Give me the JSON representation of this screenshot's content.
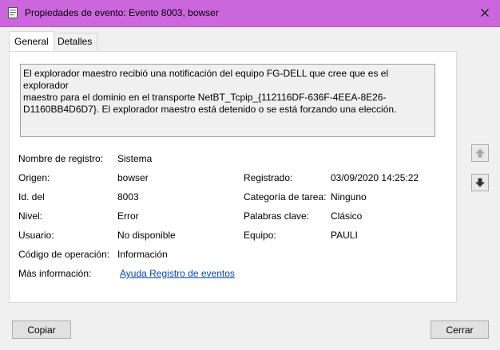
{
  "window": {
    "title": "Propiedades de evento: Evento 8003, bowser"
  },
  "tabs": [
    {
      "label": "General"
    },
    {
      "label": "Detalles"
    }
  ],
  "description": "El explorador maestro recibió una notificación del equipo FG-DELL que cree que es el explorador\nmaestro para el dominio en el transporte NetBT_Tcpip_{112116DF-636F-4EEA-8E26-\nD1160BB4D6D7}. El explorador maestro está detenido o se está forzando una elección.",
  "fields": {
    "log_name": {
      "label": "Nombre de registro:",
      "value": "Sistema"
    },
    "source": {
      "label": "Origen:",
      "value": "bowser"
    },
    "logged": {
      "label": "Registrado:",
      "value": "03/09/2020 14:25:22"
    },
    "event_id": {
      "label": "Id. del",
      "value": "8003"
    },
    "task_category": {
      "label": "Categoría de tarea:",
      "value": "Ninguno"
    },
    "level": {
      "label": "Nivel:",
      "value": "Error"
    },
    "keywords": {
      "label": "Palabras clave:",
      "value": "Clásico"
    },
    "user": {
      "label": "Usuario:",
      "value": "No disponible"
    },
    "computer": {
      "label": "Equipo:",
      "value": "PAULI"
    },
    "opcode": {
      "label": "Código de operación:",
      "value": "Información"
    },
    "more_info": {
      "label": "Más información:",
      "link": "Ayuda Registro de eventos"
    }
  },
  "buttons": {
    "copy": "Copiar",
    "close": "Cerrar"
  },
  "colors": {
    "titlebar": "#cc66dd",
    "link": "#0645ad"
  },
  "icons": {
    "window": "event-properties-icon",
    "close": "close-icon",
    "previous": "arrow-up-icon",
    "next": "arrow-down-icon"
  }
}
